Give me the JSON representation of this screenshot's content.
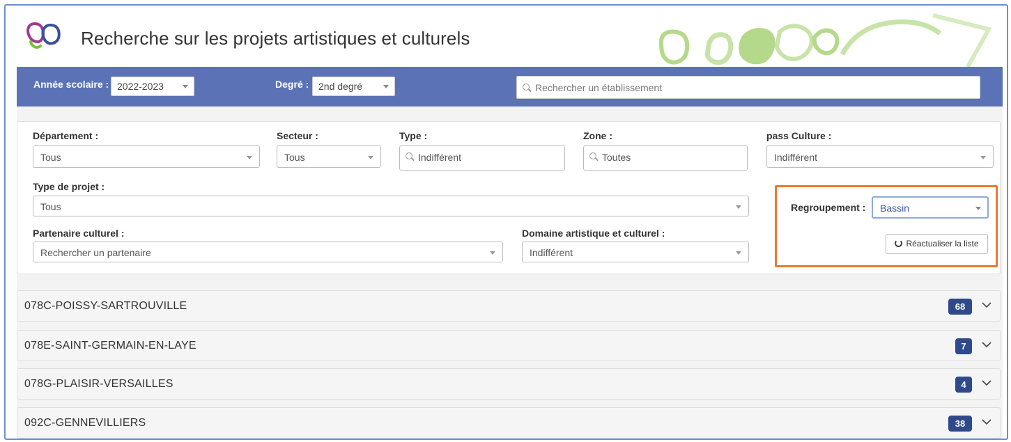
{
  "header": {
    "title": "Recherche sur les projets artistiques et culturels",
    "logo_icon": "logo-icon"
  },
  "toolbar": {
    "year_label": "Année scolaire :",
    "year_value": "2022-2023",
    "degree_label": "Degré :",
    "degree_value": "2nd degré",
    "search_placeholder": "Rechercher un établissement"
  },
  "filters": {
    "departement_label": "Département :",
    "departement_value": "Tous",
    "secteur_label": "Secteur :",
    "secteur_value": "Tous",
    "type_label": "Type :",
    "type_value": "Indifférent",
    "zone_label": "Zone :",
    "zone_value": "Toutes",
    "pass_label": "pass Culture :",
    "pass_value": "Indifférent",
    "type_projet_label": "Type de projet :",
    "type_projet_value": "Tous",
    "partenaire_label": "Partenaire culturel :",
    "partenaire_placeholder": "Rechercher un partenaire",
    "domaine_label": "Domaine artistique et culturel :",
    "domaine_value": "Indifférent"
  },
  "grouping": {
    "label": "Regroupement :",
    "value": "Bassin",
    "refresh_label": "Réactualiser la liste"
  },
  "groups": [
    {
      "name": "078C-POISSY-SARTROUVILLE",
      "count": "68"
    },
    {
      "name": "078E-SAINT-GERMAIN-EN-LAYE",
      "count": "7"
    },
    {
      "name": "078G-PLAISIR-VERSAILLES",
      "count": "4"
    },
    {
      "name": "092C-GENNEVILLIERS",
      "count": "38"
    }
  ],
  "colors": {
    "header_bar": "#5b73b6",
    "badge": "#2f4a8a",
    "highlight": "#ea7b2e",
    "deco_green": "#b5d98a"
  }
}
